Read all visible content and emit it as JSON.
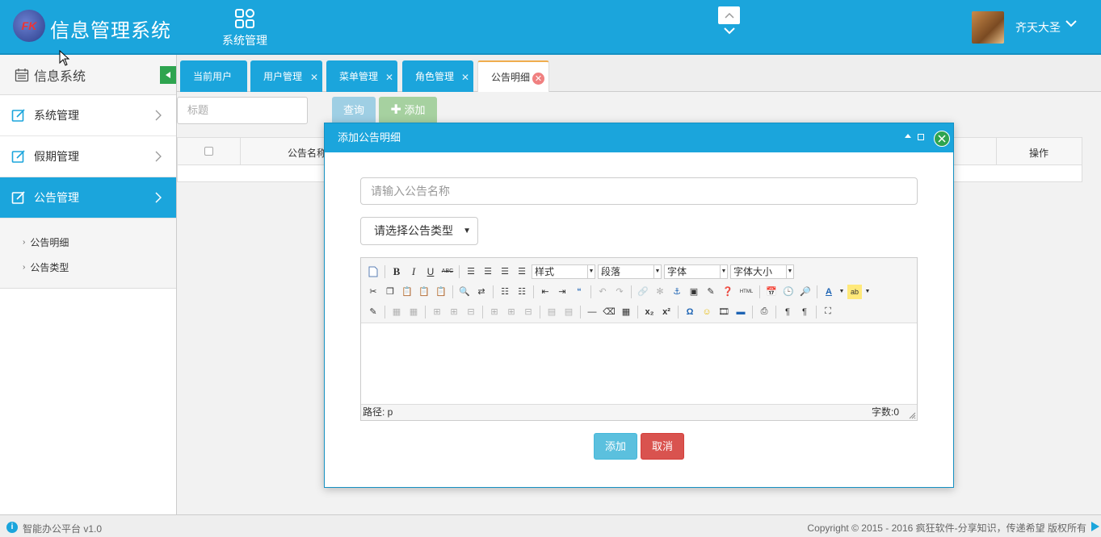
{
  "header": {
    "logo_text": "FK",
    "app_title": "信息管理系统",
    "top_nav_label": "系统管理",
    "username": "齐天大圣"
  },
  "sidebar": {
    "title": "信息系统",
    "items": [
      {
        "label": "系统管理"
      },
      {
        "label": "假期管理"
      },
      {
        "label": "公告管理"
      }
    ],
    "sub_items": [
      {
        "label": "公告明细"
      },
      {
        "label": "公告类型"
      }
    ]
  },
  "tabs": [
    {
      "label": "当前用户"
    },
    {
      "label": "用户管理"
    },
    {
      "label": "菜单管理"
    },
    {
      "label": "角色管理"
    },
    {
      "label": "公告明细"
    }
  ],
  "toolbar": {
    "search_placeholder": "标题",
    "query_label": "查询",
    "add_label": "添加"
  },
  "grid": {
    "columns": [
      "公告名称",
      "操作"
    ]
  },
  "modal": {
    "title": "添加公告明细",
    "name_placeholder": "请输入公告名称",
    "type_select": "请选择公告类型",
    "editor": {
      "style_select": "样式",
      "paragraph_select": "段落",
      "font_select": "字体",
      "fontsize_select": "字体大小",
      "path_label": "路径: p",
      "word_count": "字数:0",
      "html_label": "HTML"
    },
    "add_button": "添加",
    "cancel_button": "取消"
  },
  "footer": {
    "version": "智能办公平台 v1.0",
    "copyright": "Copyright © 2015 - 2016 疯狂软件-分享知识，传递希望 版权所有"
  },
  "colors": {
    "primary": "#1ba5dc",
    "success": "#2ea44f",
    "info": "#5bc0de",
    "danger": "#d9534f"
  }
}
